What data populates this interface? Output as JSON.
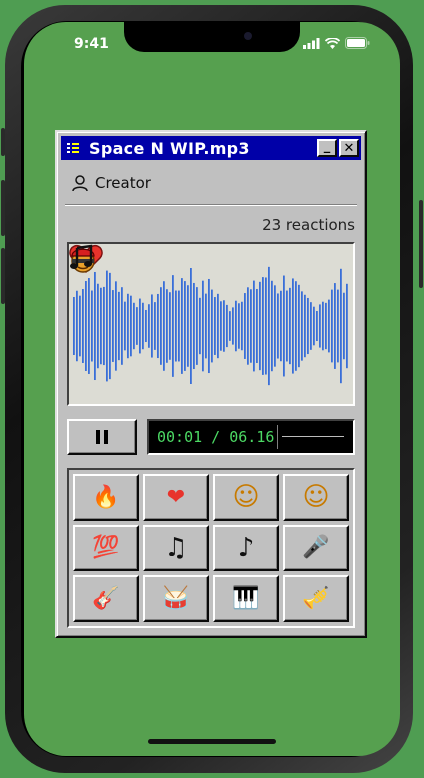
{
  "status_bar": {
    "time": "9:41"
  },
  "window": {
    "title": "Space N WIP.mp3",
    "minimize_label": "_",
    "close_label": "✕"
  },
  "creator": {
    "label": "Creator"
  },
  "reactions": {
    "count_text": "23 reactions"
  },
  "waveform": {
    "color": "#3a6fd8",
    "floating_reactions": [
      "heart-icon",
      "face-with-cap-icon",
      "music-note-icon"
    ]
  },
  "player": {
    "time_text": "00:01 / 06.16",
    "state": "playing"
  },
  "reaction_buttons": [
    {
      "name": "fire",
      "glyph": "🔥"
    },
    {
      "name": "heart",
      "glyph": "❤"
    },
    {
      "name": "face",
      "glyph": "☺"
    },
    {
      "name": "angel",
      "glyph": "☺"
    },
    {
      "name": "hundred",
      "glyph": "💯"
    },
    {
      "name": "note",
      "glyph": "♫"
    },
    {
      "name": "notes",
      "glyph": "♪"
    },
    {
      "name": "microphone",
      "glyph": "🎤"
    },
    {
      "name": "guitar",
      "glyph": "🎸"
    },
    {
      "name": "drum",
      "glyph": "🥁"
    },
    {
      "name": "piano",
      "glyph": "🎹"
    },
    {
      "name": "trumpet",
      "glyph": "🎺"
    }
  ]
}
